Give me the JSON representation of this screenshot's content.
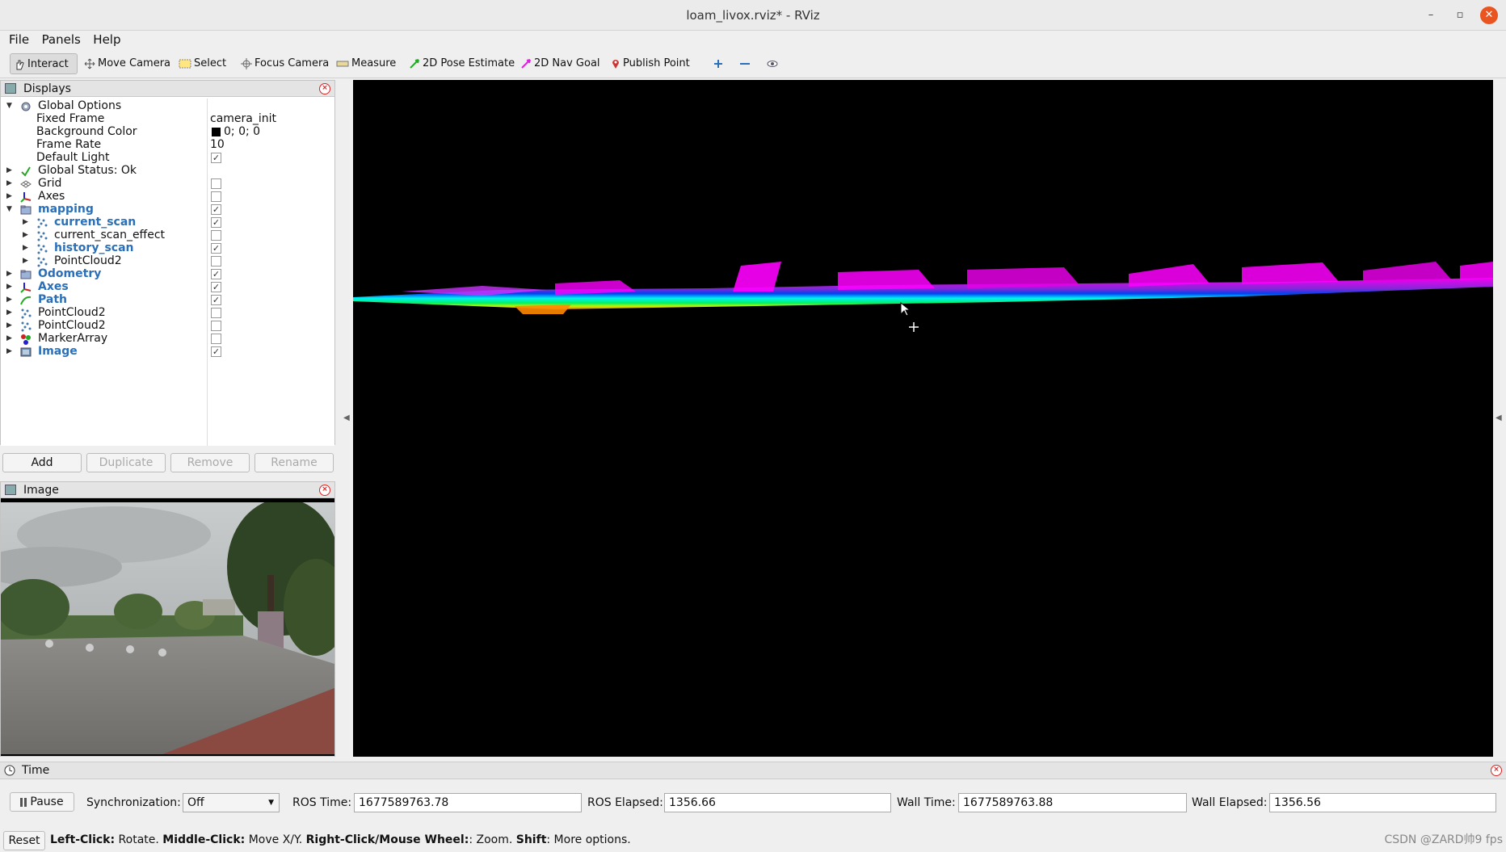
{
  "window": {
    "title": "loam_livox.rviz* - RViz",
    "minimize": "–",
    "restore": "▫",
    "close": "✕"
  },
  "menu": {
    "file": "File",
    "panels": "Panels",
    "help": "Help"
  },
  "toolbar": {
    "interact": "Interact",
    "move_camera": "Move Camera",
    "select": "Select",
    "focus_camera": "Focus Camera",
    "measure": "Measure",
    "pose_estimate": "2D Pose Estimate",
    "nav_goal": "2D Nav Goal",
    "publish_point": "Publish Point"
  },
  "displays": {
    "title": "Displays",
    "rows": [
      {
        "label": "Global Options",
        "value": "",
        "checked": null
      },
      {
        "label": "Fixed Frame",
        "value": "camera_init"
      },
      {
        "label": "Background Color",
        "value": "0; 0; 0"
      },
      {
        "label": "Frame Rate",
        "value": "10"
      },
      {
        "label": "Default Light",
        "checked": true
      },
      {
        "label": "Global Status: Ok"
      },
      {
        "label": "Grid",
        "checked": false
      },
      {
        "label": "Axes",
        "checked": false
      },
      {
        "label": "mapping",
        "checked": true
      },
      {
        "label": "current_scan",
        "checked": true
      },
      {
        "label": "current_scan_effect",
        "checked": false
      },
      {
        "label": "history_scan",
        "checked": true
      },
      {
        "label": "PointCloud2",
        "checked": false
      },
      {
        "label": "Odometry",
        "checked": true
      },
      {
        "label": "Axes",
        "checked": true
      },
      {
        "label": "Path",
        "checked": true
      },
      {
        "label": "PointCloud2",
        "checked": false
      },
      {
        "label": "PointCloud2",
        "checked": false
      },
      {
        "label": "MarkerArray",
        "checked": false
      },
      {
        "label": "Image",
        "checked": true
      }
    ],
    "buttons": {
      "add": "Add",
      "duplicate": "Duplicate",
      "remove": "Remove",
      "rename": "Rename"
    }
  },
  "image_panel": {
    "title": "Image"
  },
  "time_panel": {
    "title": "Time",
    "pause": "Pause",
    "sync_label": "Synchronization:",
    "sync_value": "Off",
    "ros_time_label": "ROS Time:",
    "ros_time": "1677589763.78",
    "ros_elapsed_label": "ROS Elapsed:",
    "ros_elapsed": "1356.66",
    "wall_time_label": "Wall Time:",
    "wall_time": "1677589763.88",
    "wall_elapsed_label": "Wall Elapsed:",
    "wall_elapsed": "1356.56"
  },
  "status": {
    "reset": "Reset",
    "left_click": "Left-Click:",
    "left_click_desc": " Rotate. ",
    "middle_click": "Middle-Click:",
    "middle_click_desc": " Move X/Y. ",
    "right_click": "Right-Click/Mouse Wheel:",
    "right_click_desc": ": Zoom. ",
    "shift": "Shift",
    "shift_desc": ": More options.",
    "watermark": "CSDN @ZARD帅9 fps"
  },
  "colors": {
    "accent": "#2a6fb8",
    "close": "#e95420",
    "viewport_bg": "#000000"
  }
}
